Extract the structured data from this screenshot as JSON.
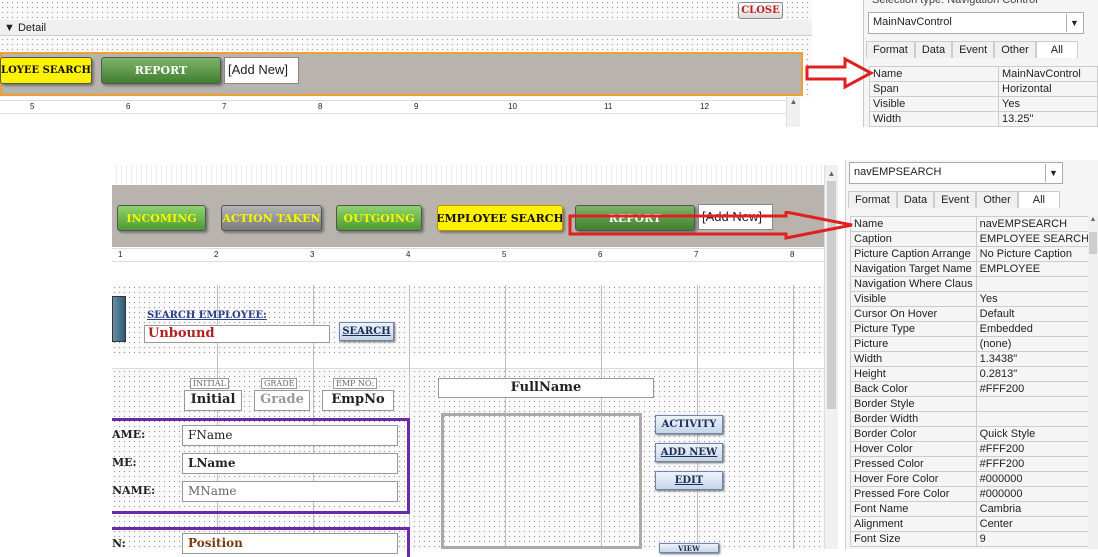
{
  "top": {
    "close_label": "CLOSE",
    "detail_label": "Detail",
    "nav_buttons": [
      "LOYEE SEARCH",
      "REPORT"
    ],
    "add_new": "[Add New]",
    "ruler": [
      "5",
      "6",
      "7",
      "8",
      "9",
      "10",
      "11",
      "12"
    ]
  },
  "top_props": {
    "selection_type": "Selection type:  Navigation Control",
    "combo_value": "MainNavControl",
    "tabs": [
      "Format",
      "Data",
      "Event",
      "Other",
      "All"
    ],
    "rows": [
      [
        "Name",
        "MainNavControl"
      ],
      [
        "Span",
        "Horizontal"
      ],
      [
        "Visible",
        "Yes"
      ],
      [
        "Width",
        "13.25\""
      ]
    ]
  },
  "form": {
    "nav_buttons": [
      "INCOMING",
      "ACTION TAKEN",
      "OUTGOING",
      "EMPLOYEE SEARCH",
      "REPORT"
    ],
    "add_new": "[Add New]",
    "ruler": [
      "1",
      "2",
      "3",
      "4",
      "5",
      "6",
      "7",
      "8"
    ],
    "search_label": "SEARCH EMPLOYEE:",
    "search_value": "Unbound",
    "search_button": "SEARCH",
    "initial_caption": "INITIAL",
    "initial_value": "Initial",
    "grade_caption": "GRADE",
    "grade_value": "Grade",
    "empno_caption": "EMP NO:",
    "empno_value": "EmpNo",
    "fullname": "FullName",
    "fname_label": "AME:",
    "fname_value": "FName",
    "lname_label": "ME:",
    "lname_value": "LName",
    "mname_label": "NAME:",
    "mname_value": "MName",
    "pos_label": "N:",
    "pos_value": "Position",
    "activity_button": "ACTIVITY",
    "addnew_button": "ADD NEW",
    "edit_button": "EDIT",
    "partial_button": "VIEW"
  },
  "bottom_props": {
    "combo_value": "navEMPSEARCH",
    "tabs": [
      "Format",
      "Data",
      "Event",
      "Other",
      "All"
    ],
    "rows": [
      [
        "Name",
        "navEMPSEARCH"
      ],
      [
        "Caption",
        "EMPLOYEE SEARCH"
      ],
      [
        "Picture Caption Arrange",
        "No Picture Caption"
      ],
      [
        "Navigation Target Name",
        "EMPLOYEE"
      ],
      [
        "Navigation Where Claus",
        ""
      ],
      [
        "Visible",
        "Yes"
      ],
      [
        "Cursor On Hover",
        "Default"
      ],
      [
        "Picture Type",
        "Embedded"
      ],
      [
        "Picture",
        "(none)"
      ],
      [
        "Width",
        "1.3438\""
      ],
      [
        "Height",
        "0.2813\""
      ],
      [
        "Back Color",
        "#FFF200"
      ],
      [
        "Border Style",
        ""
      ],
      [
        "Border Width",
        ""
      ],
      [
        "Border Color",
        "Quick Style"
      ],
      [
        "Hover Color",
        "#FFF200"
      ],
      [
        "Pressed Color",
        "#FFF200"
      ],
      [
        "Hover Fore Color",
        "#000000"
      ],
      [
        "Pressed Fore Color",
        "#000000"
      ],
      [
        "Font Name",
        "Cambria"
      ],
      [
        "Alignment",
        "Center"
      ],
      [
        "Font Size",
        "9"
      ]
    ]
  },
  "colors": {
    "arrow": "#e02020",
    "nav_border": "#f0a030",
    "form_purple": "#6a2aa8"
  }
}
